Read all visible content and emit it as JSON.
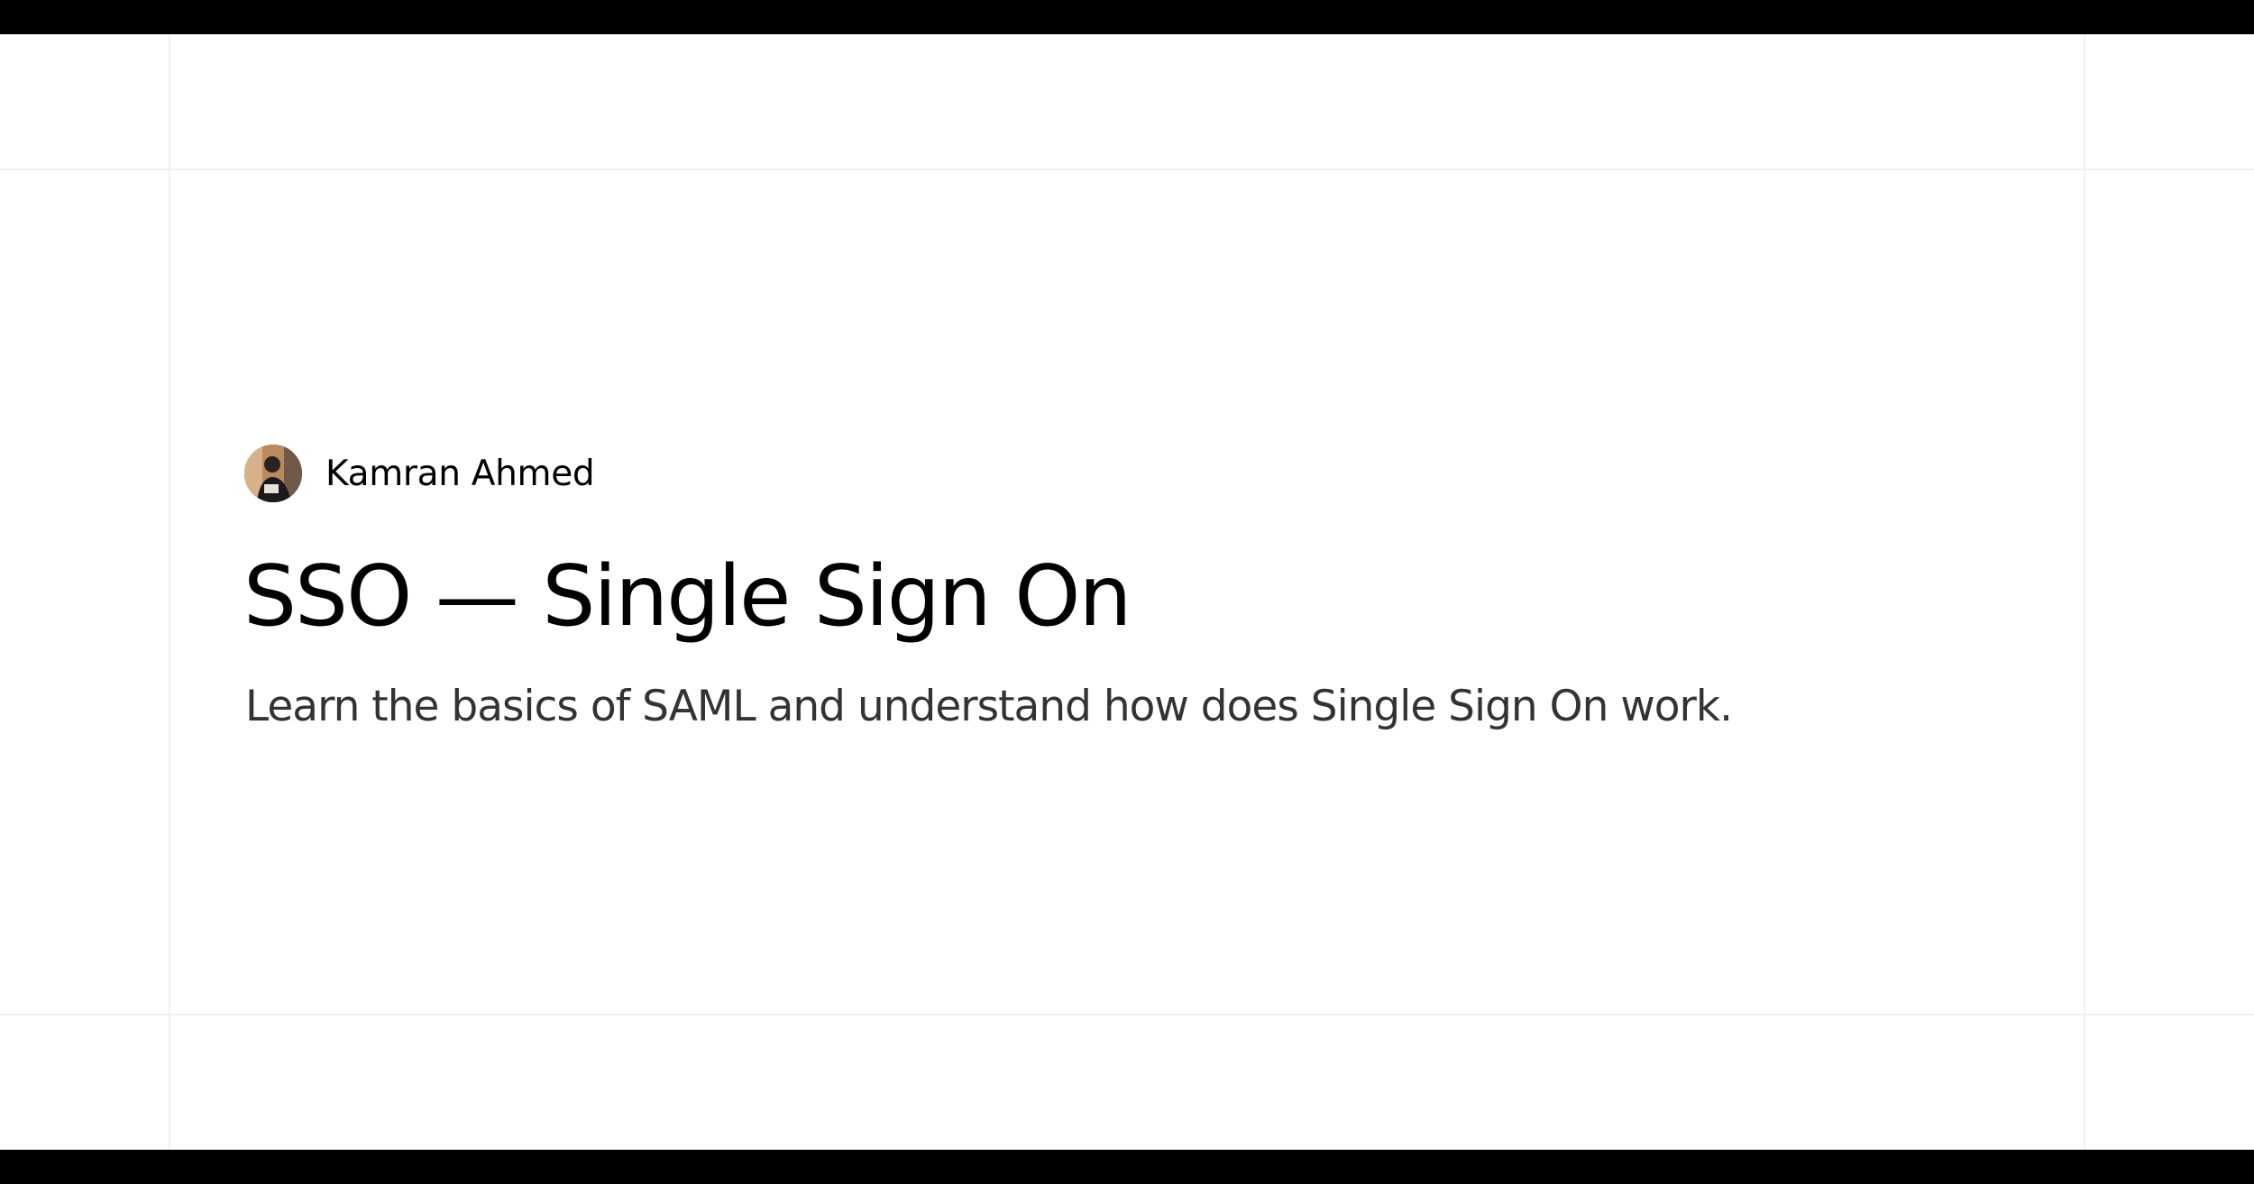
{
  "author": {
    "name": "Kamran Ahmed",
    "avatar_icon": "author-avatar-photo"
  },
  "post": {
    "title": "SSO — Single Sign On",
    "description": "Learn the basics of SAML and understand how does Single Sign On work."
  },
  "colors": {
    "frame_bars": "#000000",
    "background": "#ffffff",
    "grid_lines": "#f1f1f1",
    "title": "#000000",
    "description": "#333333"
  }
}
